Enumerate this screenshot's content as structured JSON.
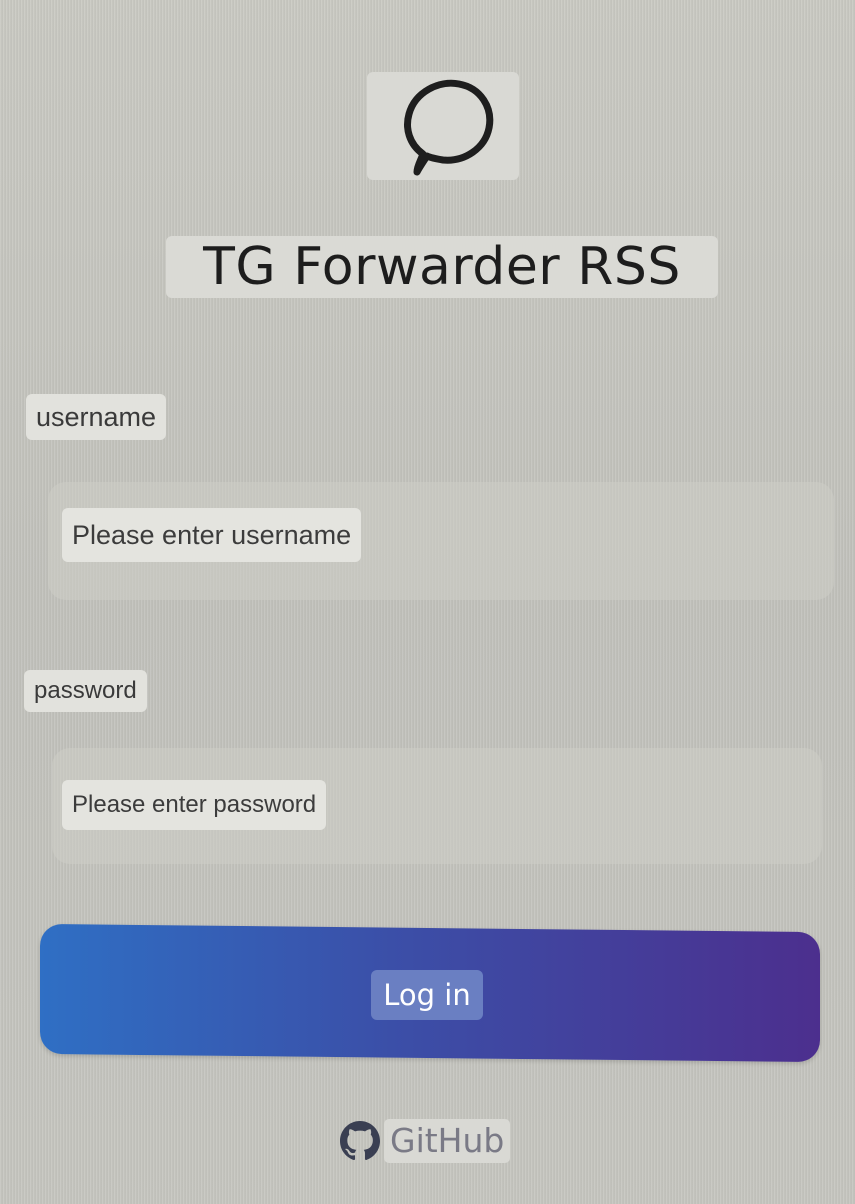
{
  "app": {
    "title": "TG Forwarder RSS",
    "logo_icon": "chat-bubble-icon"
  },
  "form": {
    "username_label": "username",
    "username_placeholder": "Please enter username",
    "password_label": "password",
    "password_placeholder": "Please enter password",
    "login_label": "Log in"
  },
  "footer": {
    "github_label": "GitHub",
    "github_icon": "github-icon"
  },
  "colors": {
    "button_gradient_start": "#2f6fc4",
    "button_gradient_end": "#4c2f8e",
    "background": "#c3c3bd"
  }
}
